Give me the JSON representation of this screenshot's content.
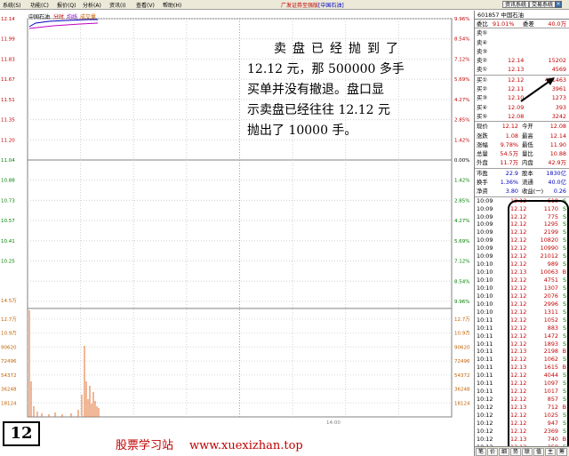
{
  "menubar": {
    "items": [
      "系统(S)",
      "功能(C)",
      "报价(Q)",
      "分析(A)",
      "资讯(I)",
      "查看(V)",
      "帮助(H)"
    ],
    "window_title": "广发证券至强版",
    "window_stock": "[中国石油]",
    "right_buttons": [
      "资讯系统",
      "交易系统"
    ]
  },
  "chart": {
    "stock_name": "中国石油",
    "tab_labels": [
      "分时",
      "均线",
      "成交量"
    ],
    "price_labels": [
      "12.14",
      "11.99",
      "11.83",
      "11.67",
      "11.51",
      "11.35",
      "11.20",
      "11.04",
      "10.88",
      "10.73",
      "10.57",
      "10.41",
      "10.25"
    ],
    "pct_labels": [
      "9.96%",
      "8.54%",
      "7.12%",
      "5.69%",
      "4.27%",
      "2.85%",
      "1.42%",
      "0.00%",
      "1.42%",
      "2.85%",
      "4.27%",
      "5.69%",
      "7.12%",
      "8.54%",
      "9.96%"
    ],
    "volume_title": "14.5万",
    "volume_labels": [
      "12.7万",
      "10.9万",
      "90620",
      "72496",
      "54372",
      "36248",
      "18124"
    ],
    "time_label": "14:00"
  },
  "quote": {
    "title": "601857 中国石油",
    "weibi_label": "委比",
    "weibi": "91.01%",
    "weicha_label": "委差",
    "weicha": "40.0万",
    "asks": [
      {
        "label": "卖⑤",
        "price": "",
        "vol": ""
      },
      {
        "label": "卖④",
        "price": "",
        "vol": ""
      },
      {
        "label": "卖③",
        "price": "",
        "vol": ""
      },
      {
        "label": "卖②",
        "price": "12.14",
        "vol": "15202"
      },
      {
        "label": "卖①",
        "price": "12.13",
        "vol": "4569"
      }
    ],
    "bids": [
      {
        "label": "买①",
        "price": "12.12",
        "vol": "411463"
      },
      {
        "label": "买②",
        "price": "12.11",
        "vol": "3961"
      },
      {
        "label": "买③",
        "price": "12.10",
        "vol": "1273"
      },
      {
        "label": "买④",
        "price": "12.09",
        "vol": "393"
      },
      {
        "label": "买⑤",
        "price": "12.08",
        "vol": "3242"
      }
    ],
    "stats": [
      {
        "a": "现价",
        "b": "12.12",
        "c": "今开",
        "d": "12.08"
      },
      {
        "a": "涨跌",
        "b": "1.08",
        "c": "最高",
        "d": "12.14"
      },
      {
        "a": "涨幅",
        "b": "9.78%",
        "c": "最低",
        "d": "11.90"
      },
      {
        "a": "总量",
        "b": "54.5万",
        "c": "量比",
        "d": "10.88"
      },
      {
        "a": "外盘",
        "b": "11.7万",
        "c": "内盘",
        "d": "42.9万"
      }
    ],
    "fin": [
      {
        "a": "市盈",
        "b": "22.9",
        "c": "股本",
        "d": "1830亿"
      },
      {
        "a": "换手",
        "b": "1.36%",
        "c": "流通",
        "d": "40.0亿"
      },
      {
        "a": "净资",
        "b": "3.80",
        "c": "收益(一)",
        "d": "0.26"
      }
    ],
    "ticks": [
      {
        "t": "10:09",
        "p": "12.12",
        "v": "618",
        "f": "S"
      },
      {
        "t": "10:09",
        "p": "12.12",
        "v": "1170",
        "f": "S"
      },
      {
        "t": "10:09",
        "p": "12.12",
        "v": "775",
        "f": "S"
      },
      {
        "t": "10:09",
        "p": "12.12",
        "v": "1295",
        "f": "S"
      },
      {
        "t": "10:09",
        "p": "12.12",
        "v": "2199",
        "f": "S"
      },
      {
        "t": "10:09",
        "p": "12.12",
        "v": "10820",
        "f": "S"
      },
      {
        "t": "10:09",
        "p": "12.12",
        "v": "10990",
        "f": "S"
      },
      {
        "t": "10:09",
        "p": "12.12",
        "v": "21012",
        "f": "S"
      },
      {
        "t": "10:10",
        "p": "12.12",
        "v": "989",
        "f": "S"
      },
      {
        "t": "10:10",
        "p": "12.13",
        "v": "10063",
        "f": "B"
      },
      {
        "t": "10:10",
        "p": "12.12",
        "v": "4751",
        "f": "S"
      },
      {
        "t": "10:10",
        "p": "12.12",
        "v": "1307",
        "f": "S"
      },
      {
        "t": "10:10",
        "p": "12.12",
        "v": "2076",
        "f": "S"
      },
      {
        "t": "10:10",
        "p": "12.12",
        "v": "2996",
        "f": "S"
      },
      {
        "t": "10:10",
        "p": "12.12",
        "v": "1311",
        "f": "S"
      },
      {
        "t": "10:11",
        "p": "12.12",
        "v": "1052",
        "f": "S"
      },
      {
        "t": "10:11",
        "p": "12.12",
        "v": "883",
        "f": "S"
      },
      {
        "t": "10:11",
        "p": "12.12",
        "v": "1472",
        "f": "S"
      },
      {
        "t": "10:11",
        "p": "12.12",
        "v": "1893",
        "f": "S"
      },
      {
        "t": "10:11",
        "p": "12.13",
        "v": "2198",
        "f": "B"
      },
      {
        "t": "10:11",
        "p": "12.12",
        "v": "1062",
        "f": "S"
      },
      {
        "t": "10:11",
        "p": "12.13",
        "v": "1615",
        "f": "B"
      },
      {
        "t": "10:11",
        "p": "12.12",
        "v": "4044",
        "f": "S"
      },
      {
        "t": "10:11",
        "p": "12.12",
        "v": "1097",
        "f": "S"
      },
      {
        "t": "10:11",
        "p": "12.12",
        "v": "1017",
        "f": "S"
      },
      {
        "t": "10:12",
        "p": "12.12",
        "v": "857",
        "f": "S"
      },
      {
        "t": "10:12",
        "p": "12.13",
        "v": "712",
        "f": "B"
      },
      {
        "t": "10:12",
        "p": "12.12",
        "v": "1025",
        "f": "S"
      },
      {
        "t": "10:12",
        "p": "12.12",
        "v": "947",
        "f": "S"
      },
      {
        "t": "10:12",
        "p": "12.12",
        "v": "2369",
        "f": "S"
      },
      {
        "t": "10:12",
        "p": "12.13",
        "v": "740",
        "f": "B"
      },
      {
        "t": "10:12",
        "p": "12.12",
        "v": "258",
        "f": "S"
      }
    ],
    "tabs": [
      "笔",
      "价",
      "细",
      "势",
      "联",
      "值",
      "主",
      "筹"
    ]
  },
  "annotation": {
    "lines": [
      "卖盘已经抛到了",
      "12.12 元，那 500000 多手",
      "买单并没有撤退。盘口显",
      "示卖盘已经往往 12.12 元",
      "抛出了 10000 手。"
    ],
    "badge": "12",
    "footer_site": "股票学习站",
    "footer_url": "www.xuexizhan.top"
  },
  "colors": {
    "up": "#c00000",
    "down": "#008000",
    "grid": "#c0c0c0",
    "price_line": "#0000c0",
    "avg_line": "#c000c0"
  }
}
